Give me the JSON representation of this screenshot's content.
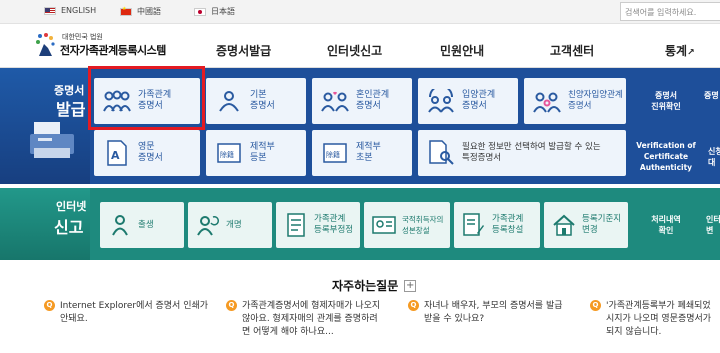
{
  "topbar": {
    "languages": [
      "ENGLISH",
      "中國語",
      "日本語"
    ],
    "search_placeholder": "검색어를 입력하세요."
  },
  "logo": {
    "small": "대한민국 법원",
    "title": "전자가족관계등록시스템"
  },
  "nav": [
    "증명서발급",
    "인터넷신고",
    "민원안내",
    "고객센터",
    "통계"
  ],
  "issue": {
    "label_top": "증명서",
    "label_big": "발급",
    "tiles": [
      {
        "l1": "가족관계",
        "l2": "증명서"
      },
      {
        "l1": "기본",
        "l2": "증명서"
      },
      {
        "l1": "혼인관계",
        "l2": "증명서"
      },
      {
        "l1": "입양관계",
        "l2": "증명서"
      },
      {
        "l1": "친양자입양관계",
        "l2": "증명서"
      },
      {
        "l1": "영문",
        "l2": "증명서"
      },
      {
        "l1": "제적부",
        "l2": "등본"
      },
      {
        "l1": "제적부",
        "l2": "초본"
      },
      {
        "l1": "필요한 정보만 선택하여 발급할 수 있는",
        "l2": "특정증명서"
      }
    ],
    "side": [
      {
        "l1": "증명서",
        "l2": "진위확인"
      },
      {
        "l1": "Verification of",
        "l2": "Certificate",
        "l3": "Authenticity"
      }
    ],
    "edge": [
      "증명",
      "신청",
      "대"
    ]
  },
  "report": {
    "label_top": "인터넷",
    "label_big": "신고",
    "tiles": [
      {
        "l1": "출생",
        "l2": ""
      },
      {
        "l1": "개명",
        "l2": ""
      },
      {
        "l1": "가족관계",
        "l2": "등록부정정"
      },
      {
        "l1": "국적취득자의",
        "l2": "성본창설"
      },
      {
        "l1": "가족관계",
        "l2": "등록창설"
      },
      {
        "l1": "등록기준지",
        "l2": "변경"
      }
    ],
    "side": {
      "l1": "처리내역",
      "l2": "확인"
    },
    "edge": [
      "인터",
      "변"
    ]
  },
  "faq": {
    "title": "자주하는질문",
    "items": [
      {
        "l1": "Internet Explorer에서 증명서 인쇄가",
        "l2": "안돼요."
      },
      {
        "l1": "가족관계증명서에 형제자매가 나오지",
        "l2": "않아요. 형제자매의 관계를 증명하려",
        "l3": "면 어떻게 해야 하나요..."
      },
      {
        "l1": "자녀나 배우자, 부모의 증명서를 발급",
        "l2": "받을 수 있나요?"
      },
      {
        "l1": "'가족관계등록부가 폐쇄되었",
        "l2": "시지가 나오며 영문증명서가",
        "l3": "되지 않습니다."
      }
    ]
  },
  "colors": {
    "issue_bg": "#1e4f9a",
    "report_bg": "#1e8a7e",
    "highlight": "#e31b23",
    "faq_icon": "#f59a23"
  }
}
